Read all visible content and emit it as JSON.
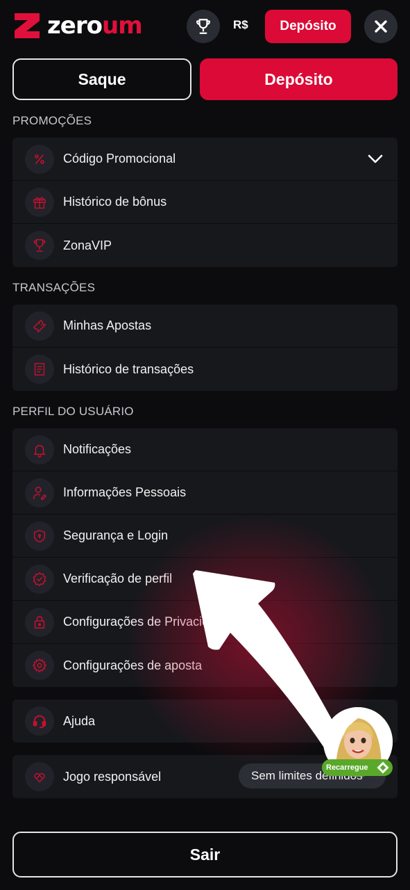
{
  "header": {
    "logo_text_white": "zero",
    "logo_text_red": "um",
    "currency": "R$",
    "deposit_label": "Depósito",
    "icons": {
      "trophy": "trophy-icon",
      "close": "close-icon"
    }
  },
  "actions": {
    "withdraw_label": "Saque",
    "deposit_label": "Depósito"
  },
  "promotions": {
    "title": "PROMOÇÕES",
    "items": [
      {
        "label": "Código Promocional",
        "icon": "percent-icon"
      },
      {
        "label": "Histórico de bônus",
        "icon": "gift-icon"
      },
      {
        "label": "ZonaVIP",
        "icon": "trophy-icon"
      }
    ]
  },
  "transactions": {
    "title": "TRANSAÇÕES",
    "items": [
      {
        "label": "Minhas Apostas",
        "icon": "ticket-icon"
      },
      {
        "label": "Histórico de transações",
        "icon": "receipt-icon"
      }
    ]
  },
  "profile": {
    "title": "PERFIL DO USUÁRIO",
    "items": [
      {
        "label": "Notificações",
        "icon": "bell-icon"
      },
      {
        "label": "Informações Pessoais",
        "icon": "user-edit-icon"
      },
      {
        "label": "Segurança e Login",
        "icon": "shield-icon"
      },
      {
        "label": "Verificação de perfil",
        "icon": "verified-badge-icon"
      },
      {
        "label": "Configurações de Privacidade",
        "icon": "lock-icon"
      },
      {
        "label": "Configurações de aposta",
        "icon": "gear-icon"
      }
    ]
  },
  "help": {
    "label": "Ajuda",
    "icon": "headset-icon"
  },
  "responsible": {
    "label": "Jogo responsável",
    "icon": "heart-hands-icon",
    "status": "Sem limites definidos"
  },
  "promo_widget": {
    "badge_label": "Recarregue"
  },
  "logout_label": "Sair",
  "colors": {
    "accent": "#dc0a36",
    "background": "#0c0c0e",
    "card": "#17181c",
    "badge": "#59a82a"
  }
}
